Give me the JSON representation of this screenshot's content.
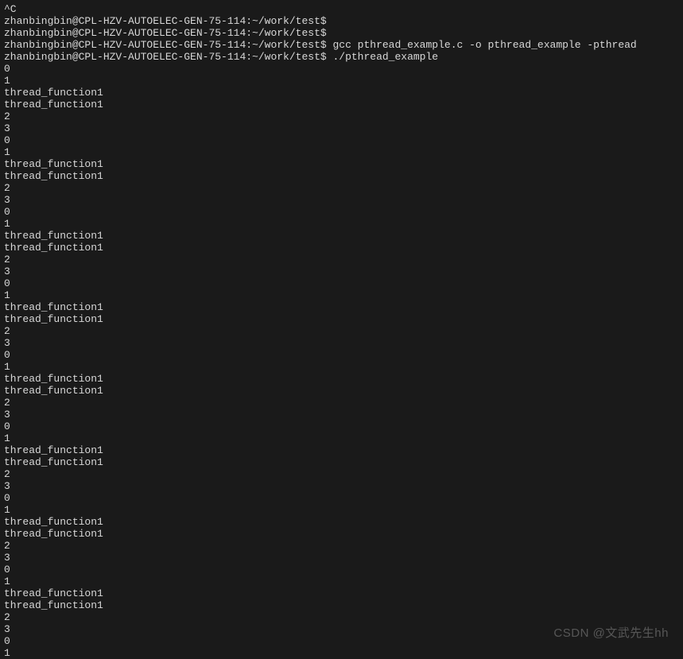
{
  "terminal": {
    "interrupt": "^C",
    "prompt": "zhanbingbin@CPL-HZV-AUTOELEC-GEN-75-114:~/work/test$ ",
    "compile_cmd": "gcc pthread_example.c -o pthread_example -pthread",
    "run_cmd": "./pthread_example",
    "repeat_block": [
      "0",
      "1",
      "thread_function1",
      "thread_function1",
      "2",
      "3"
    ],
    "tail_lines": [
      "0",
      "1"
    ],
    "repeat_count": 8
  },
  "watermark": "CSDN @文武先生hh"
}
